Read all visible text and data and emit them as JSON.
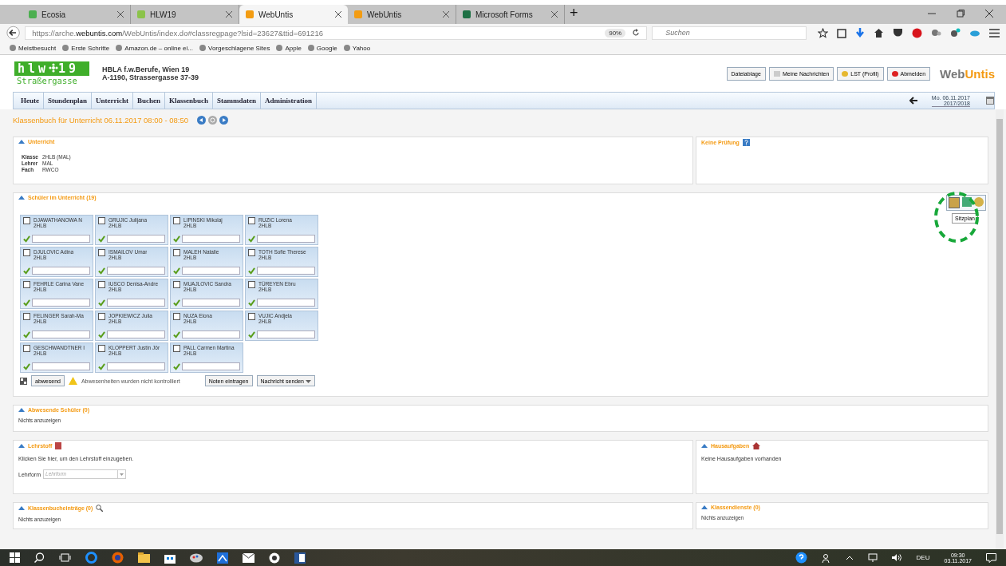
{
  "browser": {
    "tabs": [
      {
        "title": "Ecosia",
        "selected": false,
        "kind": "ecosia"
      },
      {
        "title": "HLW19",
        "selected": false,
        "kind": "school"
      },
      {
        "title": "WebUntis",
        "selected": true,
        "kind": "untis"
      },
      {
        "title": "WebUntis",
        "selected": false,
        "kind": "untis"
      },
      {
        "title": "Microsoft Forms",
        "selected": false,
        "kind": "forms"
      }
    ],
    "new_tab": "+",
    "url_host": "https://arche.",
    "url_domain": "webuntis.com",
    "url_path": "/WebUntis/index.do#classregpage?lsid=23627&ttid=691216",
    "zoom": "90%",
    "search": {
      "placeholder": "Suchen"
    },
    "bookmarks": [
      "Meistbesucht",
      "Erste Schritte",
      "Amazon.de – online ei...",
      "Vorgeschlagene Sites",
      "Apple",
      "Google",
      "Yahoo"
    ]
  },
  "header": {
    "logo_top": "hlw",
    "logo_num": "19",
    "logo_sub": "Straßergasse",
    "school": [
      "HBLA f.w.Berufe, Wien 19",
      "A-1190, Strassergasse 37-39"
    ],
    "buttons": [
      "Dateiablage",
      "Meine Nachrichten",
      "LST (Profil)",
      "Abmelden"
    ],
    "brand_a": "Web",
    "brand_b": "Untis"
  },
  "menu": [
    "Heute",
    "Stundenplan",
    "Unterricht",
    "Buchen",
    "Klassenbuch",
    "Stammdaten",
    "Administration"
  ],
  "date": {
    "day": "Mo. 06.11.2017",
    "year": "2017/2018"
  },
  "page_title": "Klassenbuch für Unterricht 06.11.2017 08:00 - 08:50",
  "unterricht": {
    "title": "Unterricht",
    "fields": [
      {
        "label": "Klasse",
        "value": "2HLB (MAL)"
      },
      {
        "label": "Lehrer",
        "value": "MAL"
      },
      {
        "label": "Fach",
        "value": "RWCO"
      }
    ]
  },
  "pruefung": {
    "title": "Keine Prüfung"
  },
  "schueler": {
    "title": "Schüler im Unterricht (19)",
    "tooltip": "Sitzplan",
    "students": [
      {
        "name": "DJAWATHANOWA N",
        "class": "2HLB",
        "checked": false,
        "present": true
      },
      {
        "name": "GRUJIC Julijana",
        "class": "2HLB",
        "checked": false,
        "present": true
      },
      {
        "name": "LIPINSKI Mikolaj",
        "class": "2HLB",
        "checked": false,
        "present": true
      },
      {
        "name": "RUZIC Lorena",
        "class": "2HLB",
        "checked": false,
        "present": true
      },
      {
        "name": "DJULOVIC Adina",
        "class": "2HLB",
        "checked": false,
        "present": true
      },
      {
        "name": "ISMAILOV Umar",
        "class": "2HLB",
        "checked": false,
        "present": true
      },
      {
        "name": "MALEH Natalie",
        "class": "2HLB",
        "checked": false,
        "present": true
      },
      {
        "name": "TOTH Sofie Therese",
        "class": "2HLB",
        "checked": false,
        "present": true
      },
      {
        "name": "FEHRLE Carina Vane",
        "class": "2HLB",
        "checked": false,
        "present": true
      },
      {
        "name": "IUSCO Denisa-Andre",
        "class": "2HLB",
        "checked": false,
        "present": true
      },
      {
        "name": "MUAJLOVIC Sandra",
        "class": "2HLB",
        "checked": false,
        "present": true
      },
      {
        "name": "TÜREYEN Ebru",
        "class": "2HLB",
        "checked": false,
        "present": true
      },
      {
        "name": "FELINGER Sarah-Ma",
        "class": "2HLB",
        "checked": false,
        "present": true
      },
      {
        "name": "JOPKIEWICZ Julia",
        "class": "2HLB",
        "checked": false,
        "present": true
      },
      {
        "name": "NUZA Elona",
        "class": "2HLB",
        "checked": false,
        "present": true
      },
      {
        "name": "VUJIC Andjela",
        "class": "2HLB",
        "checked": false,
        "present": true
      },
      {
        "name": "GESCHWANDTNER I",
        "class": "2HLB",
        "checked": false,
        "present": true
      },
      {
        "name": "KLOPPERT Justin Jör",
        "class": "2HLB",
        "checked": false,
        "present": true
      },
      {
        "name": "PALL Carmen Martina",
        "class": "2HLB",
        "checked": false,
        "present": true
      }
    ],
    "absent_button": "abwesend",
    "warning": "Abwesenheiten wurden nicht kontrolliert",
    "grades_button": "Noten eintragen",
    "message_button": "Nachricht senden"
  },
  "abwesende": {
    "title": "Abwesende Schüler (0)",
    "text": "Nichts anzuzeigen"
  },
  "lehrstoff": {
    "title": "Lehrstoff",
    "text": "Klicken Sie hier, um den Lehrstoff einzugeben.",
    "form_label": "Lehrform",
    "form_placeholder": "Lehrform"
  },
  "hausaufgaben": {
    "title": "Hausaufgaben",
    "text": "Keine Hausaufgaben vorhanden"
  },
  "eintraege": {
    "title": "Klassenbucheinträge (0)",
    "text": "Nichts anzuzeigen"
  },
  "dienste": {
    "title": "Klassendienste (0)",
    "text": "Nichts anzuzeigen"
  },
  "taskbar": {
    "language": "DEU",
    "time": "09:30",
    "date": "03.11.2017"
  }
}
